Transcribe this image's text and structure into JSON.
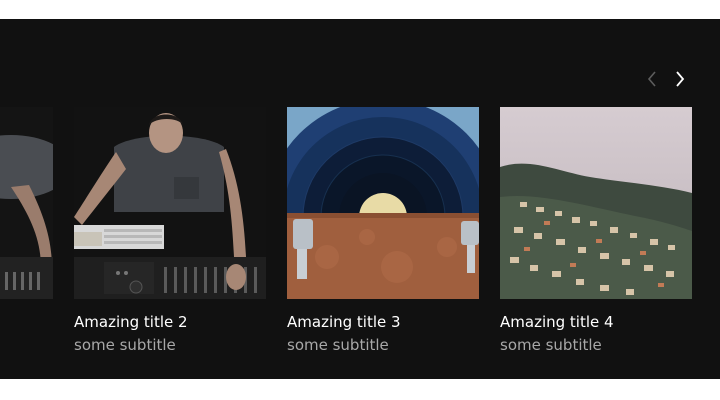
{
  "carousel": {
    "cards": [
      {
        "title": "",
        "subtitle": "",
        "image": "man-at-mixing-desk-cropped"
      },
      {
        "title": "Amazing title 2",
        "subtitle": "some subtitle",
        "image": "man-at-mixing-desk"
      },
      {
        "title": "Amazing title 3",
        "subtitle": "some subtitle",
        "image": "vinyl-record-in-case"
      },
      {
        "title": "Amazing title 4",
        "subtitle": "some subtitle",
        "image": "foggy-hillside-town"
      }
    ],
    "nav": {
      "prev_icon": "chevron-left-icon",
      "next_icon": "chevron-right-icon"
    }
  },
  "colors": {
    "background": "#111111",
    "title": "#ffffff",
    "subtitle": "#a8a8a8"
  }
}
